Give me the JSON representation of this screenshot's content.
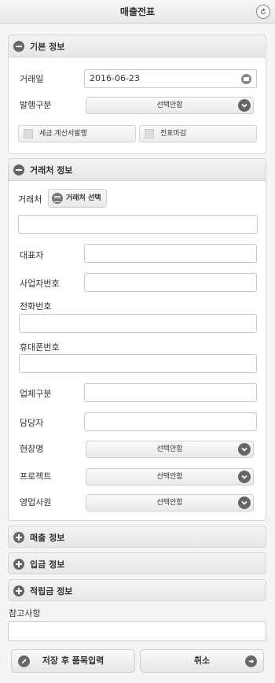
{
  "header": {
    "title": "매출전표"
  },
  "basic": {
    "title": "기본 정보",
    "date_label": "거래일",
    "date_value": "2016-06-23",
    "issue_label": "발행구분",
    "issue_value": "선택안함",
    "tax_invoice_label": "세금.계산서발행",
    "close_label": "전표마감"
  },
  "client": {
    "title": "거래처 정보",
    "client_label": "거래처",
    "client_select_label": "거래처 선택",
    "client_value": "",
    "rep_label": "대표자",
    "bizno_label": "사업자번호",
    "phone_label": "전화번호",
    "mobile_label": "휴대폰번호",
    "biztype_label": "업체구분",
    "manager_label": "담당자",
    "site_label": "현장명",
    "site_value": "선택안함",
    "project_label": "프로젝트",
    "project_value": "선택안함",
    "sales_rep_label": "영업사원",
    "sales_rep_value": "선택안함"
  },
  "collapsed": {
    "sales": "매출 정보",
    "deposit": "입금 정보",
    "reserve": "적립금 정보"
  },
  "notes": {
    "label": "참고사항",
    "value": ""
  },
  "actions": {
    "save": "저장 후 품목입력",
    "cancel": "취소"
  }
}
